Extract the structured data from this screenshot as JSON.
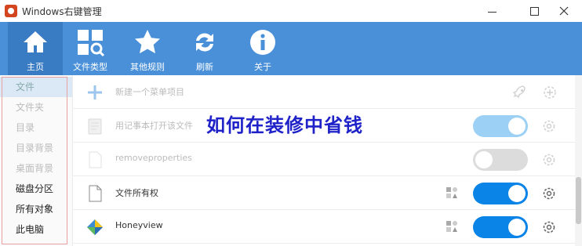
{
  "window": {
    "title": "Windows右键管理"
  },
  "toolbar": {
    "items": [
      {
        "label": "主页",
        "icon": "home-icon"
      },
      {
        "label": "文件类型",
        "icon": "file-types-icon"
      },
      {
        "label": "其他规则",
        "icon": "star-icon"
      },
      {
        "label": "刷新",
        "icon": "refresh-icon"
      },
      {
        "label": "关于",
        "icon": "info-icon"
      }
    ]
  },
  "sidebar": {
    "items": [
      {
        "label": "文件"
      },
      {
        "label": "文件夹"
      },
      {
        "label": "目录"
      },
      {
        "label": "目录背景"
      },
      {
        "label": "桌面背景"
      },
      {
        "label": "磁盘分区"
      },
      {
        "label": "所有对象"
      },
      {
        "label": "此电脑"
      }
    ]
  },
  "list": {
    "new_item_label": "新建一个菜单项目",
    "rows": [
      {
        "name": "用记事本打开该文件",
        "enabled": true
      },
      {
        "name": "removeproperties",
        "enabled": false
      },
      {
        "name": "文件所有权",
        "enabled": true
      },
      {
        "name": "Honeyview",
        "enabled": true
      }
    ]
  },
  "overlay": {
    "watermark": "如何在装修中省钱"
  },
  "colors": {
    "toolbar": "#4a90d9",
    "toggle_on": "#0a84e6",
    "watermark": "#1f22c8"
  }
}
